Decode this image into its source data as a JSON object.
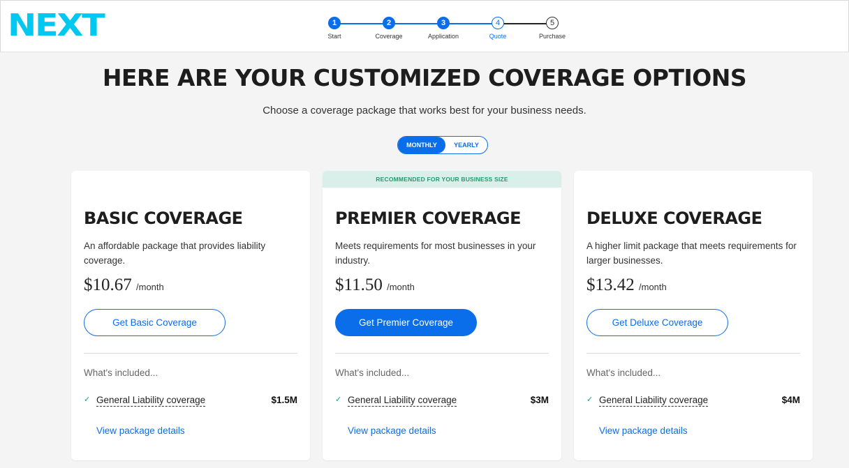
{
  "brand": {
    "logo_text": "NEXT",
    "logo_color": "#00c8f0",
    "accent": "#0a6dea"
  },
  "stepper": {
    "steps": [
      {
        "num": "1",
        "label": "Start",
        "state": "done"
      },
      {
        "num": "2",
        "label": "Coverage",
        "state": "done"
      },
      {
        "num": "3",
        "label": "Application",
        "state": "done"
      },
      {
        "num": "4",
        "label": "Quote",
        "state": "current"
      },
      {
        "num": "5",
        "label": "Purchase",
        "state": "future"
      }
    ]
  },
  "page": {
    "title": "HERE ARE YOUR CUSTOMIZED COVERAGE OPTIONS",
    "subtitle": "Choose a coverage package that works best for your business needs."
  },
  "billing_toggle": {
    "monthly": "MONTHLY",
    "yearly": "YEARLY",
    "selected": "MONTHLY"
  },
  "plans": [
    {
      "banner": "",
      "name": "BASIC COVERAGE",
      "description": "An affordable package that provides liability coverage.",
      "price": "$10.67",
      "period": "/month",
      "cta": "Get Basic Coverage",
      "included_label": "What's included...",
      "coverage_name": "General Liability coverage",
      "coverage_amount": "$1.5M",
      "details_link": "View package details"
    },
    {
      "banner": "RECOMMENDED FOR YOUR BUSINESS SIZE",
      "name": "PREMIER COVERAGE",
      "description": "Meets requirements for most businesses in your industry.",
      "price": "$11.50",
      "period": "/month",
      "cta": "Get Premier Coverage",
      "included_label": "What's included...",
      "coverage_name": "General Liability coverage",
      "coverage_amount": "$3M",
      "details_link": "View package details"
    },
    {
      "banner": "",
      "name": "DELUXE COVERAGE",
      "description": "A higher limit package that meets requirements for larger businesses.",
      "price": "$13.42",
      "period": "/month",
      "cta": "Get Deluxe Coverage",
      "included_label": "What's included...",
      "coverage_name": "General Liability coverage",
      "coverage_amount": "$4M",
      "details_link": "View package details"
    }
  ],
  "icons": {
    "check": "check-icon"
  }
}
